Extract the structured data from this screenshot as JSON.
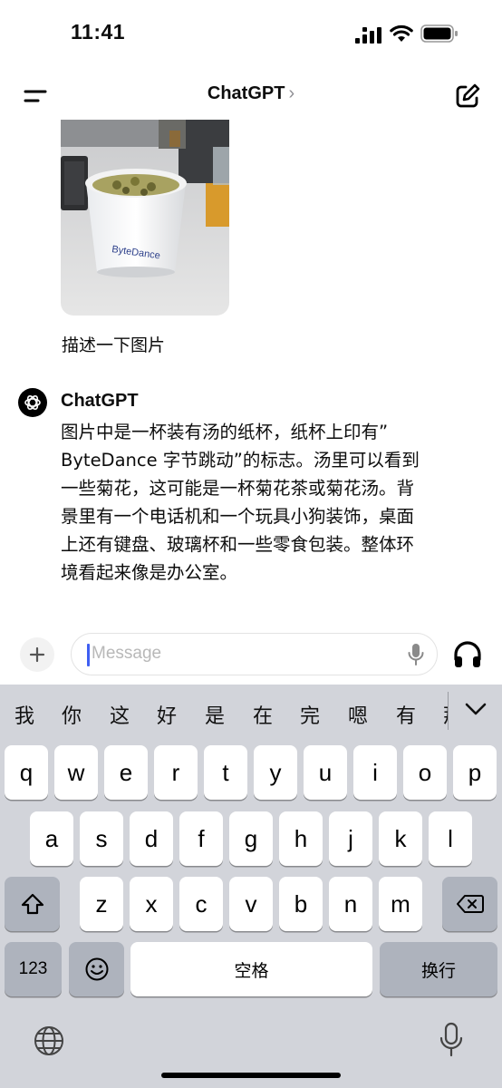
{
  "status_bar": {
    "time": "11:41"
  },
  "nav": {
    "title": "ChatGPT",
    "chevron": "›"
  },
  "conversation": {
    "user_message": "描述一下图片",
    "assistant": {
      "name": "ChatGPT",
      "lines": [
        "图片中是一杯装有汤的纸杯，纸杯上印有”",
        "ByteDance 字节跳动”的标志。汤里可以看到",
        "一些菊花，这可能是一杯菊花茶或菊花汤。背",
        "景里有一个电话机和一个玩具小狗装饰，桌面",
        "上还有键盘、玻璃杯和一些零食包装。整体环",
        "境看起来像是办公室。"
      ]
    },
    "photo_cup_text": "ByteDance"
  },
  "composer": {
    "placeholder": "Message",
    "plus": "+"
  },
  "keyboard": {
    "candidates": [
      "我",
      "你",
      "这",
      "好",
      "是",
      "在",
      "完",
      "嗯",
      "有",
      "那"
    ],
    "row1": [
      "q",
      "w",
      "e",
      "r",
      "t",
      "y",
      "u",
      "i",
      "o",
      "p"
    ],
    "row2": [
      "a",
      "s",
      "d",
      "f",
      "g",
      "h",
      "j",
      "k",
      "l"
    ],
    "row3": [
      "z",
      "x",
      "c",
      "v",
      "b",
      "n",
      "m"
    ],
    "numbers_key": "123",
    "space_key": "空格",
    "return_key": "换行"
  },
  "icons": {
    "signal": "signal-icon",
    "wifi": "wifi-icon",
    "battery": "battery-icon",
    "menu": "menu-icon",
    "new_chat": "new-chat-icon",
    "plus": "plus-icon",
    "mic": "mic-icon",
    "headphones": "headphones-icon",
    "shift": "shift-icon",
    "backspace": "backspace-icon",
    "emoji": "emoji-icon",
    "globe": "globe-icon",
    "dictation": "dictation-icon",
    "chevron_down": "chevron-down-icon",
    "openai_logo": "openai-logo-icon"
  },
  "colors": {
    "cursor": "#3f5ff2",
    "keyboard_bg": "#d2d4da",
    "special_key": "#aeb3bd"
  }
}
